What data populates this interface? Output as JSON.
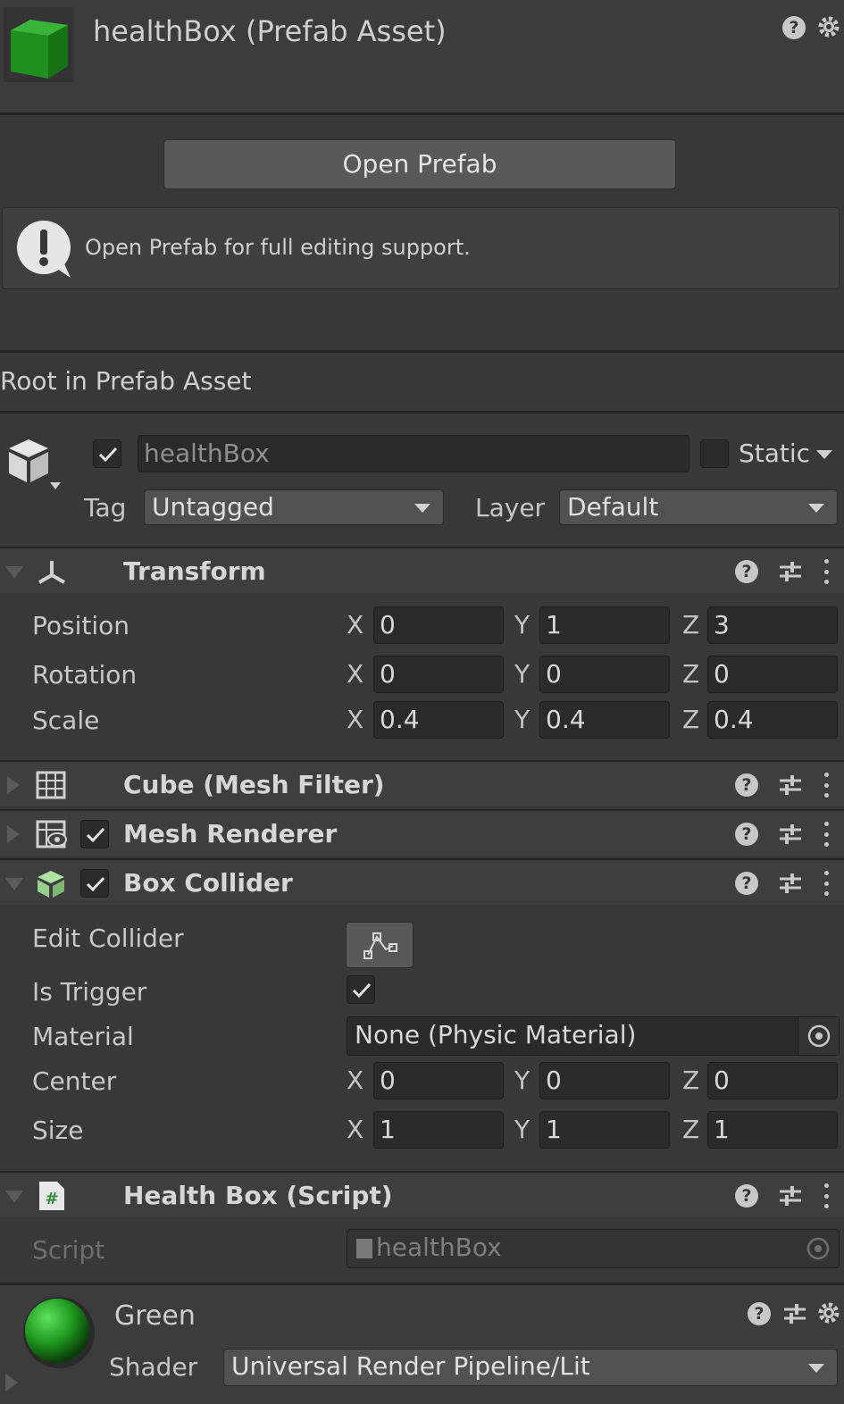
{
  "asset": {
    "title": "healthBox (Prefab Asset)",
    "thumbnail_color": "#1f9a1f",
    "help_icon": "help-icon",
    "settings_icon": "gear-icon"
  },
  "open_prefab_label": "Open Prefab",
  "info_box": {
    "icon": "info-bubble-icon",
    "text": "Open Prefab for full editing support."
  },
  "section_label": "Root in Prefab Asset",
  "gameobject": {
    "active": true,
    "name": "healthBox",
    "static_label": "Static",
    "static_checked": false,
    "tag_label": "Tag",
    "tag_value": "Untagged",
    "layer_label": "Layer",
    "layer_value": "Default"
  },
  "transform": {
    "title": "Transform",
    "rows": [
      {
        "label": "Position",
        "x": "0",
        "y": "1",
        "z": "3"
      },
      {
        "label": "Rotation",
        "x": "0",
        "y": "0",
        "z": "0"
      },
      {
        "label": "Scale",
        "x": "0.4",
        "y": "0.4",
        "z": "0.4"
      }
    ]
  },
  "axes": {
    "x": "X",
    "y": "Y",
    "z": "Z"
  },
  "mesh_filter": {
    "title": "Cube (Mesh Filter)"
  },
  "mesh_renderer": {
    "title": "Mesh Renderer",
    "enabled": true
  },
  "box_collider": {
    "title": "Box Collider",
    "enabled": true,
    "edit_collider_label": "Edit Collider",
    "is_trigger_label": "Is Trigger",
    "is_trigger": true,
    "material_label": "Material",
    "material_value": "None (Physic Material)",
    "center_label": "Center",
    "center": {
      "x": "0",
      "y": "0",
      "z": "0"
    },
    "size_label": "Size",
    "size": {
      "x": "1",
      "y": "1",
      "z": "1"
    }
  },
  "script_component": {
    "title": "Health Box (Script)",
    "script_label": "Script",
    "script_value": "healthBox"
  },
  "material": {
    "name": "Green",
    "sphere_color": "#1f9a1f",
    "shader_label": "Shader",
    "shader_value": "Universal Render Pipeline/Lit"
  }
}
